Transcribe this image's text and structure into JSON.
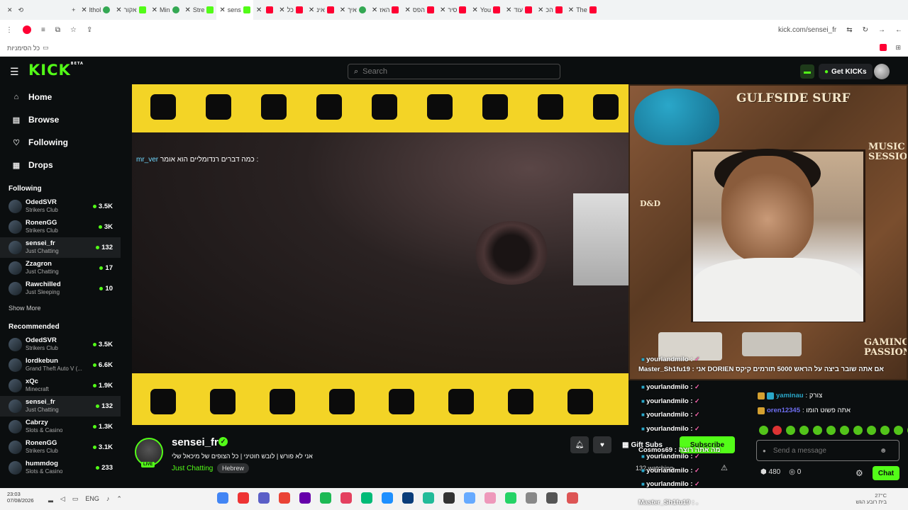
{
  "browser": {
    "tabs": [
      {
        "title": "lthol",
        "icon": "g"
      },
      {
        "title": "אקור",
        "icon": "k"
      },
      {
        "title": "Min",
        "icon": "g"
      },
      {
        "title": "Stre",
        "icon": "k"
      },
      {
        "title": "sens",
        "icon": "k",
        "active": true
      },
      {
        "title": "",
        "icon": "yt"
      },
      {
        "title": "כל",
        "icon": "yt"
      },
      {
        "title": "אינ",
        "icon": "yt"
      },
      {
        "title": "איך",
        "icon": "g"
      },
      {
        "title": "האז",
        "icon": "yt"
      },
      {
        "title": "הפס",
        "icon": "yt"
      },
      {
        "title": "סיר",
        "icon": "yt"
      },
      {
        "title": "You",
        "icon": "yt"
      },
      {
        "title": "עוד",
        "icon": "yt"
      },
      {
        "title": "הכ",
        "icon": "yt"
      },
      {
        "title": "The",
        "icon": "yt"
      }
    ],
    "url": "kick.com/sensei_fr",
    "bookmark_folder": "כל הסימניות"
  },
  "kick": {
    "logo": "KICK",
    "logo_sup": "BETA",
    "search_placeholder": "Search",
    "get_kicks": "Get KICKs",
    "nav": [
      {
        "label": "Home",
        "icon": "⌂"
      },
      {
        "label": "Browse",
        "icon": "▤"
      },
      {
        "label": "Following",
        "icon": "♡"
      },
      {
        "label": "Drops",
        "icon": "▦"
      }
    ],
    "following_title": "Following",
    "following": [
      {
        "name": "OdedSVR",
        "cat": "Strikers Club",
        "viewers": "3.5K"
      },
      {
        "name": "RonenGG",
        "cat": "Strikers Club",
        "viewers": "3K"
      },
      {
        "name": "sensei_fr",
        "cat": "Just Chatting",
        "viewers": "132",
        "active": true
      },
      {
        "name": "Zzagron",
        "cat": "Just Chatting",
        "viewers": "17"
      },
      {
        "name": "Rawchilled",
        "cat": "Just Sleeping",
        "viewers": "10"
      }
    ],
    "show_more": "Show More",
    "recommended_title": "Recommended",
    "recommended": [
      {
        "name": "OdedSVR",
        "cat": "Strikers Club",
        "viewers": "3.5K"
      },
      {
        "name": "lordkebun",
        "cat": "Grand Theft Auto V (...",
        "viewers": "6.6K"
      },
      {
        "name": "xQc",
        "cat": "Minecraft",
        "viewers": "1.9K"
      },
      {
        "name": "sensei_fr",
        "cat": "Just Chatting",
        "viewers": "132",
        "active": true
      },
      {
        "name": "Cabrzy",
        "cat": "Slots & Casino",
        "viewers": "1.3K"
      },
      {
        "name": "RonenGG",
        "cat": "Strikers Club",
        "viewers": "3.1K"
      },
      {
        "name": "hummdog",
        "cat": "Slots & Casino",
        "viewers": "233"
      }
    ]
  },
  "player": {
    "overlay_user": "mr_ver",
    "overlay_msg": "כמה דברים רנדומליים הוא אומר :"
  },
  "cam": {
    "surf": "GULFSIDE SURF",
    "music": "MUSIC SESSION",
    "gaming": "GAMING PASSION",
    "dnd": "D&D",
    "chat_lines": [
      "yourlandmilo :",
      "yourlandmilo :",
      "yourlandmilo :",
      "yourlandmilo :",
      "yourlandmilo :",
      "yourlandmilo :",
      "yourlandmilo :",
      "yourlandmilo :",
      "yourlandmilo :",
      "yourlandmilo :"
    ],
    "highlight": "Master_Sh1fu19 : אני DORIEN אם אתה שובר ביצה על הראש 5000 תורמים קיקס",
    "highlight2": "Cosmos69 : מה אתה רוצה",
    "highlight3": "Master_Sh1fu19 : ."
  },
  "chat": {
    "messages": [
      {
        "user": "yaminau",
        "text": ": צורק"
      },
      {
        "user": "oren12345",
        "text": ": אתה פשוט הומו"
      }
    ],
    "placeholder": "Send a message",
    "kicks_count": "480",
    "points": "0",
    "chat_btn": "Chat"
  },
  "stream": {
    "name": "sensei_fr",
    "live": "LIVE",
    "title": "אני לא פורש | לובש חוטיני | כל הצופים של מיכאל שלי",
    "category": "Just Chatting",
    "tag": "Hebrew",
    "gift_subs": "Gift Subs",
    "subscribe": "Subscribe",
    "watching": "132 watching"
  },
  "taskbar": {
    "time": "23:03",
    "date": "07/08/2026",
    "lang": "ENG",
    "weather": "27°C",
    "weather_desc": "בית רובע הגש"
  }
}
